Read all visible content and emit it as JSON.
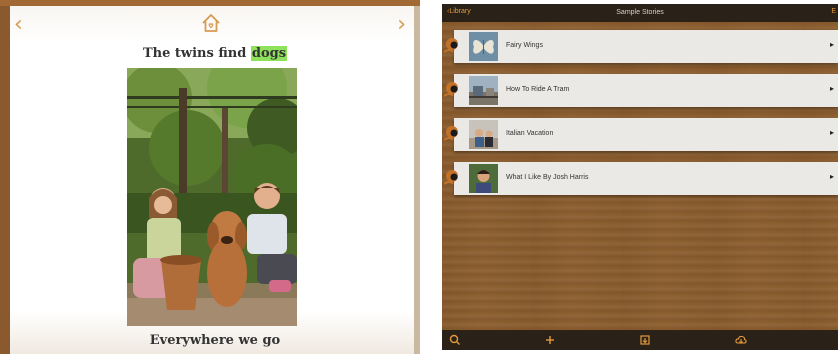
{
  "reader": {
    "title_prefix": "The twins find",
    "title_highlight": "dogs",
    "page_text": "Everywhere we go",
    "prev_icon": "chevron-left-icon",
    "next_icon": "chevron-right-icon",
    "home_icon": "home-icon",
    "accent_color": "#d79a4f",
    "highlight_color": "#8ee15b"
  },
  "library": {
    "back_label": "Library",
    "title": "Sample Stories",
    "books": [
      {
        "title": "Fairy Wings"
      },
      {
        "title": "How To Ride A Tram"
      },
      {
        "title": "Italian Vacation"
      },
      {
        "title": "What I Like By Josh Harris"
      }
    ],
    "toolbar_icons": [
      "search-icon",
      "add-icon",
      "import-icon",
      "cloud-download-icon"
    ],
    "accent_color": "#e39a3b"
  }
}
